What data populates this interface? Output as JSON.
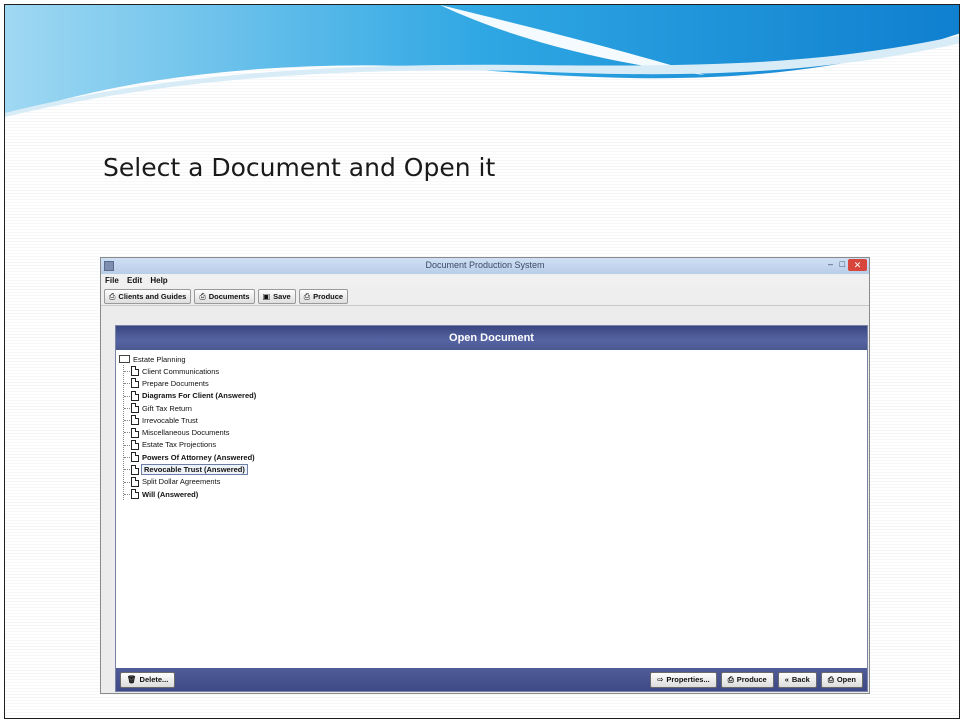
{
  "slide": {
    "title": "Select a Document and Open it"
  },
  "window": {
    "title": "Document Production System",
    "controls": {
      "minimize": "–",
      "maximize": "□",
      "close": "✕"
    }
  },
  "menu": [
    "File",
    "Edit",
    "Help"
  ],
  "toolbar": {
    "clients": "Clients and Guides",
    "documents": "Documents",
    "save": "Save",
    "produce": "Produce"
  },
  "panel": {
    "header": "Open Document",
    "root": "Estate Planning",
    "items": [
      {
        "label": "Client Communications",
        "bold": false
      },
      {
        "label": "Prepare Documents",
        "bold": false
      },
      {
        "label": "Diagrams For Client (Answered)",
        "bold": true
      },
      {
        "label": "Gift Tax Return",
        "bold": false
      },
      {
        "label": "Irrevocable Trust",
        "bold": false
      },
      {
        "label": "Miscellaneous Documents",
        "bold": false
      },
      {
        "label": "Estate Tax Projections",
        "bold": false
      },
      {
        "label": "Powers Of Attorney (Answered)",
        "bold": true
      },
      {
        "label": "Revocable Trust (Answered)",
        "bold": true,
        "selected": true
      },
      {
        "label": "Split Dollar Agreements",
        "bold": false
      },
      {
        "label": "Will (Answered)",
        "bold": true
      }
    ]
  },
  "buttons": {
    "delete": "Delete...",
    "properties": "Properties...",
    "produce": "Produce",
    "back": "Back",
    "open": "Open"
  },
  "colors": {
    "panel_header": "#4a578f",
    "bottom_bar": "#45529a",
    "close_button": "#d8453a",
    "swoosh": "#1aa0e0"
  }
}
